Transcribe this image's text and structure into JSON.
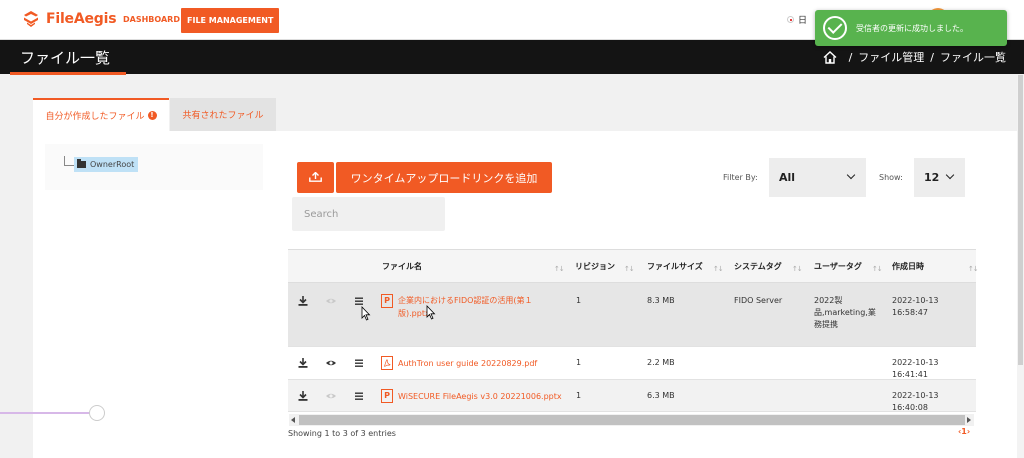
{
  "app": {
    "brand": "FileAegis",
    "nav": {
      "dashboard": "DASHBOARD",
      "file_management": "FILE MANAGEMENT"
    },
    "lang": "日",
    "accent": "#f15a24"
  },
  "toast": {
    "text": "受信者の更新に成功しました。",
    "color": "#58b34e"
  },
  "header": {
    "title": "ファイル一覧",
    "breadcrumb": [
      "ファイル管理",
      "ファイル一覧"
    ]
  },
  "tabs": {
    "own": "自分が作成したファイル",
    "own_badge": "!",
    "shared": "共有されたファイル"
  },
  "tree": {
    "root": "OwnerRoot"
  },
  "toolbar": {
    "onetime_upload_label": "ワンタイムアップロードリンクを追加",
    "filter_label": "Filter By:",
    "filter_value": "All",
    "show_label": "Show:",
    "show_value": "12",
    "search_placeholder": "Search"
  },
  "table": {
    "columns": [
      "ファイル名",
      "リビジョン",
      "ファイルサイズ",
      "システムタグ",
      "ユーザータグ",
      "作成日時"
    ],
    "rows": [
      {
        "name_line1": "企業内におけるFIDO認証の活用(第１",
        "name_line2": "版).pptx",
        "type": "pptx",
        "revision": "1",
        "size": "8.3 MB",
        "system_tag": "FIDO Server",
        "user_tag_line1": "2022製",
        "user_tag_line2": "品,marketing,業",
        "user_tag_line3": "務提携",
        "created": "2022-10-13 16:58:47"
      },
      {
        "name_line1": "AuthTron user guide 20220829.pdf",
        "type": "pdf",
        "revision": "1",
        "size": "2.2 MB",
        "system_tag": "",
        "created": "2022-10-13 16:41:41"
      },
      {
        "name_line1": "WiSECURE FileAegis v3.0 20221006.pptx",
        "type": "pptx",
        "revision": "1",
        "size": "6.3 MB",
        "system_tag": "",
        "created": "2022-10-13 16:40:08"
      }
    ],
    "footer": "Showing 1 to 3 of 3 entries",
    "pager": "‹1›"
  },
  "icons": {
    "download": "download-icon",
    "view": "eye-icon",
    "menu": "menu-icon",
    "home": "home-icon",
    "upload": "upload-icon",
    "folder": "folder-icon",
    "success": "check-circle-icon"
  }
}
